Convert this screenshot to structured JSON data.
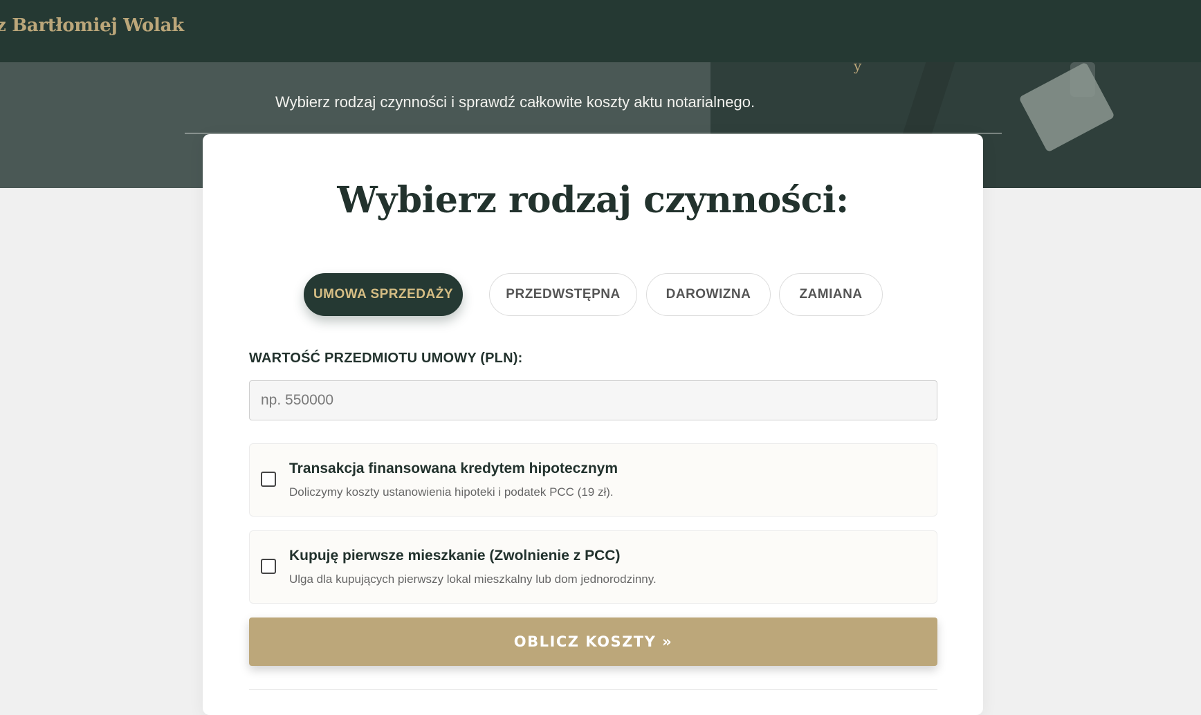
{
  "header": {
    "brand": "z Bartłomiej Wolak"
  },
  "hero": {
    "subtitle": "Wybierz rodzaj czynności i sprawdź całkowite koszty aktu notarialnego."
  },
  "calculator": {
    "title": "Wybierz rodzaj czynności:",
    "tabs": [
      {
        "label": "UMOWA SPRZEDAŻY",
        "active": true
      },
      {
        "label": "PRZEDWSTĘPNA",
        "active": false
      },
      {
        "label": "DAROWIZNA",
        "active": false
      },
      {
        "label": "ZAMIANA",
        "active": false
      }
    ],
    "value_field": {
      "label": "WARTOŚĆ PRZEDMIOTU UMOWY (PLN):",
      "placeholder": "np. 550000",
      "value": ""
    },
    "options": [
      {
        "title": "Transakcja finansowana kredytem hipotecznym",
        "description": "Doliczymy koszty ustanowienia hipoteki i podatek PCC (19 zł).",
        "checked": false
      },
      {
        "title": "Kupuję pierwsze mieszkanie (Zwolnienie z PCC)",
        "description": "Ulga dla kupujących pierwszy lokal mieszkalny lub dom jednorodzinny.",
        "checked": false
      }
    ],
    "submit_label": "OBLICZ KOSZTY »"
  },
  "colors": {
    "header_bg": "#253933",
    "accent_gold": "#bca77a",
    "tab_active_text": "#d5bd84",
    "heading_text": "#22322d",
    "page_bg": "#f0f0f0"
  }
}
